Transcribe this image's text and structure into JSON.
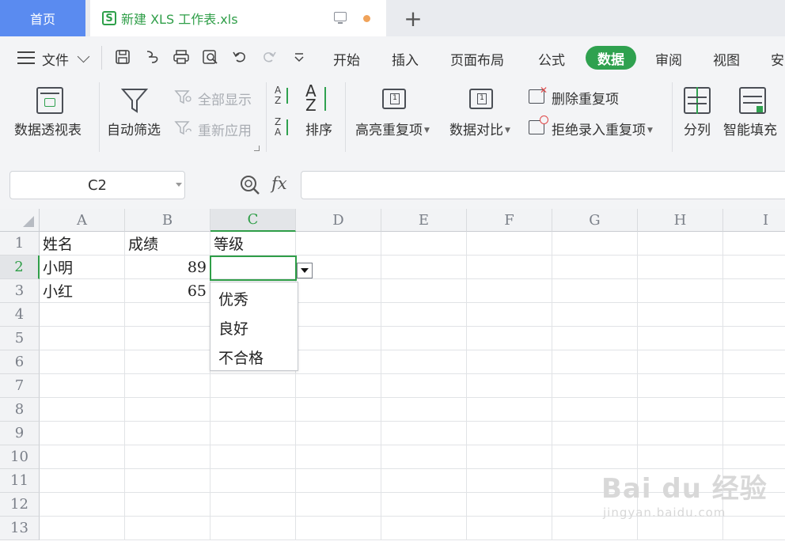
{
  "tabs": {
    "home": "首页",
    "file": "新建 XLS 工作表.xls",
    "file_icon": "S",
    "add": "+"
  },
  "menu": {
    "file": "文件",
    "items": [
      "开始",
      "插入",
      "页面布局",
      "公式",
      "数据",
      "审阅",
      "视图",
      "安"
    ],
    "active": "数据"
  },
  "ribbon": {
    "pivot": "数据透视表",
    "autofilter": "自动筛选",
    "show_all": "全部显示",
    "reapply": "重新应用",
    "sort": "排序",
    "highlight_dup": "高亮重复项",
    "compare": "数据对比",
    "remove_dup": "删除重复项",
    "reject_dup": "拒绝录入重复项",
    "split": "分列",
    "smart_fill": "智能填充"
  },
  "formula_bar": {
    "name_box": "C2",
    "fx": "fx",
    "value": ""
  },
  "grid": {
    "columns": [
      "A",
      "B",
      "C",
      "D",
      "E",
      "F",
      "G",
      "H",
      "I"
    ],
    "rows": [
      "1",
      "2",
      "3",
      "4",
      "5",
      "6",
      "7",
      "8",
      "9",
      "10",
      "11",
      "12",
      "13"
    ],
    "selected_col": "C",
    "selected_row": "2",
    "cells": {
      "A1": "姓名",
      "B1": "成绩",
      "C1": "等级",
      "A2": "小明",
      "B2": "89",
      "A3": "小红",
      "B3": "65"
    }
  },
  "dropdown": {
    "options": [
      "优秀",
      "良好",
      "不合格"
    ]
  },
  "watermark": {
    "brand": "Bai du 经验",
    "url": "jingyan.baidu.com"
  },
  "colors": {
    "accent_green": "#2fa14f",
    "home_tab_blue": "#5a8bf0"
  }
}
